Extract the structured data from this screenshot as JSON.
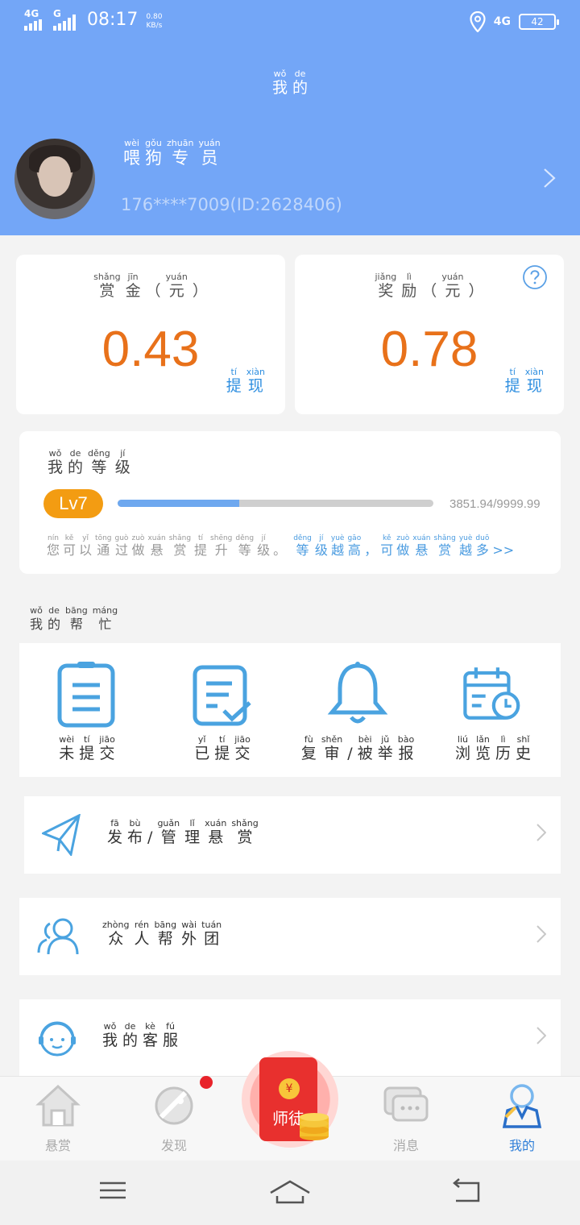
{
  "status_bar": {
    "net1": "4G",
    "net2": "G",
    "time": "08:17",
    "speed_value": "0.80",
    "speed_unit": "KB/s",
    "net_right": "4G",
    "battery": "42"
  },
  "header": {
    "title": [
      {
        "p": "wǒ",
        "h": "我"
      },
      {
        "p": "de",
        "h": "的"
      }
    ],
    "username": [
      {
        "p": "wèi",
        "h": "喂"
      },
      {
        "p": "gǒu",
        "h": "狗"
      },
      {
        "p": "zhuān",
        "h": "专"
      },
      {
        "p": "yuán",
        "h": "员"
      }
    ],
    "user_id": "176****7009(ID:2628406)"
  },
  "bounty_card": {
    "label": [
      {
        "p": "shǎng",
        "h": "赏"
      },
      {
        "p": "jīn",
        "h": "金"
      },
      {
        "p": "",
        "h": "（"
      },
      {
        "p": "yuán",
        "h": "元"
      },
      {
        "p": "",
        "h": "）"
      }
    ],
    "value": "0.43",
    "withdraw": [
      {
        "p": "tí",
        "h": "提"
      },
      {
        "p": "xiàn",
        "h": "现"
      }
    ]
  },
  "reward_card": {
    "label": [
      {
        "p": "jiǎng",
        "h": "奖"
      },
      {
        "p": "lì",
        "h": "励"
      },
      {
        "p": "",
        "h": "（"
      },
      {
        "p": "yuán",
        "h": "元"
      },
      {
        "p": "",
        "h": "）"
      }
    ],
    "value": "0.78",
    "withdraw": [
      {
        "p": "tí",
        "h": "提"
      },
      {
        "p": "xiàn",
        "h": "现"
      }
    ]
  },
  "level": {
    "title": [
      {
        "p": "wǒ",
        "h": "我"
      },
      {
        "p": "de",
        "h": "的"
      },
      {
        "p": "děng",
        "h": "等"
      },
      {
        "p": "jí",
        "h": "级"
      }
    ],
    "badge": "Lv7",
    "progress": "3851.94/9999.99",
    "progress_fraction": 0.3852,
    "tip_gray": [
      {
        "p": "nín",
        "h": "您"
      },
      {
        "p": "kě",
        "h": "可"
      },
      {
        "p": "yǐ",
        "h": "以"
      },
      {
        "p": "tōng",
        "h": "通"
      },
      {
        "p": "guò",
        "h": "过"
      },
      {
        "p": "zuò",
        "h": "做"
      },
      {
        "p": "xuán",
        "h": "悬"
      },
      {
        "p": "shǎng",
        "h": "赏"
      },
      {
        "p": "tí",
        "h": "提"
      },
      {
        "p": "shēng",
        "h": "升"
      },
      {
        "p": "děng",
        "h": "等"
      },
      {
        "p": "jí",
        "h": "级"
      },
      {
        "p": "",
        "h": "。"
      }
    ],
    "tip_blue": [
      {
        "p": "děng",
        "h": "等"
      },
      {
        "p": "jí",
        "h": "级"
      },
      {
        "p": "yuè",
        "h": "越"
      },
      {
        "p": "gāo",
        "h": "高"
      },
      {
        "p": "",
        "h": "，"
      },
      {
        "p": "kě",
        "h": "可"
      },
      {
        "p": "zuò",
        "h": "做"
      },
      {
        "p": "xuán",
        "h": "悬"
      },
      {
        "p": "shǎng",
        "h": "赏"
      },
      {
        "p": "yuè",
        "h": "越"
      },
      {
        "p": "duō",
        "h": "多"
      },
      {
        "p": "",
        "h": ">>"
      }
    ]
  },
  "my_help": {
    "title": [
      {
        "p": "wǒ",
        "h": "我"
      },
      {
        "p": "de",
        "h": "的"
      },
      {
        "p": "bāng",
        "h": "帮"
      },
      {
        "p": "máng",
        "h": "忙"
      }
    ],
    "items": [
      {
        "icon": "clipboard-icon",
        "label": [
          {
            "p": "wèi",
            "h": "未"
          },
          {
            "p": "tí",
            "h": "提"
          },
          {
            "p": "jiāo",
            "h": "交"
          }
        ]
      },
      {
        "icon": "submitted-doc-icon",
        "label": [
          {
            "p": "yǐ",
            "h": "已"
          },
          {
            "p": "tí",
            "h": "提"
          },
          {
            "p": "jiāo",
            "h": "交"
          }
        ]
      },
      {
        "icon": "bell-icon",
        "label": [
          {
            "p": "fù",
            "h": "复"
          },
          {
            "p": "shěn",
            "h": "审"
          },
          {
            "p": "",
            "h": "/"
          },
          {
            "p": "bèi",
            "h": "被"
          },
          {
            "p": "jǔ",
            "h": "举"
          },
          {
            "p": "bào",
            "h": "报"
          }
        ]
      },
      {
        "icon": "calendar-clock-icon",
        "label": [
          {
            "p": "liú",
            "h": "浏"
          },
          {
            "p": "lǎn",
            "h": "览"
          },
          {
            "p": "lì",
            "h": "历"
          },
          {
            "p": "shǐ",
            "h": "史"
          }
        ]
      }
    ]
  },
  "menu": [
    {
      "icon": "paper-plane-icon",
      "label": [
        {
          "p": "fā",
          "h": "发"
        },
        {
          "p": "bù",
          "h": "布"
        },
        {
          "p": "",
          "h": "/"
        },
        {
          "p": "guǎn",
          "h": "管"
        },
        {
          "p": "lǐ",
          "h": "理"
        },
        {
          "p": "xuán",
          "h": "悬"
        },
        {
          "p": "shǎng",
          "h": "赏"
        }
      ]
    },
    {
      "icon": "group-icon",
      "label": [
        {
          "p": "zhòng",
          "h": "众"
        },
        {
          "p": "rén",
          "h": "人"
        },
        {
          "p": "bāng",
          "h": "帮"
        },
        {
          "p": "wài",
          "h": "外"
        },
        {
          "p": "tuán",
          "h": "团"
        }
      ]
    },
    {
      "icon": "customer-service-icon",
      "label": [
        {
          "p": "wǒ",
          "h": "我"
        },
        {
          "p": "de",
          "h": "的"
        },
        {
          "p": "kè",
          "h": "客"
        },
        {
          "p": "fú",
          "h": "服"
        }
      ]
    }
  ],
  "bottom_nav": {
    "items": [
      "悬赏",
      "发现",
      "",
      "消息",
      "我的"
    ],
    "master_label": "师徒",
    "coin_symbol": "¥"
  },
  "colors": {
    "header": "#73a6f7",
    "money": "#e8711a",
    "link": "#2f8fe0",
    "badge": "#f39c12",
    "icon": "#4aa3e0"
  }
}
